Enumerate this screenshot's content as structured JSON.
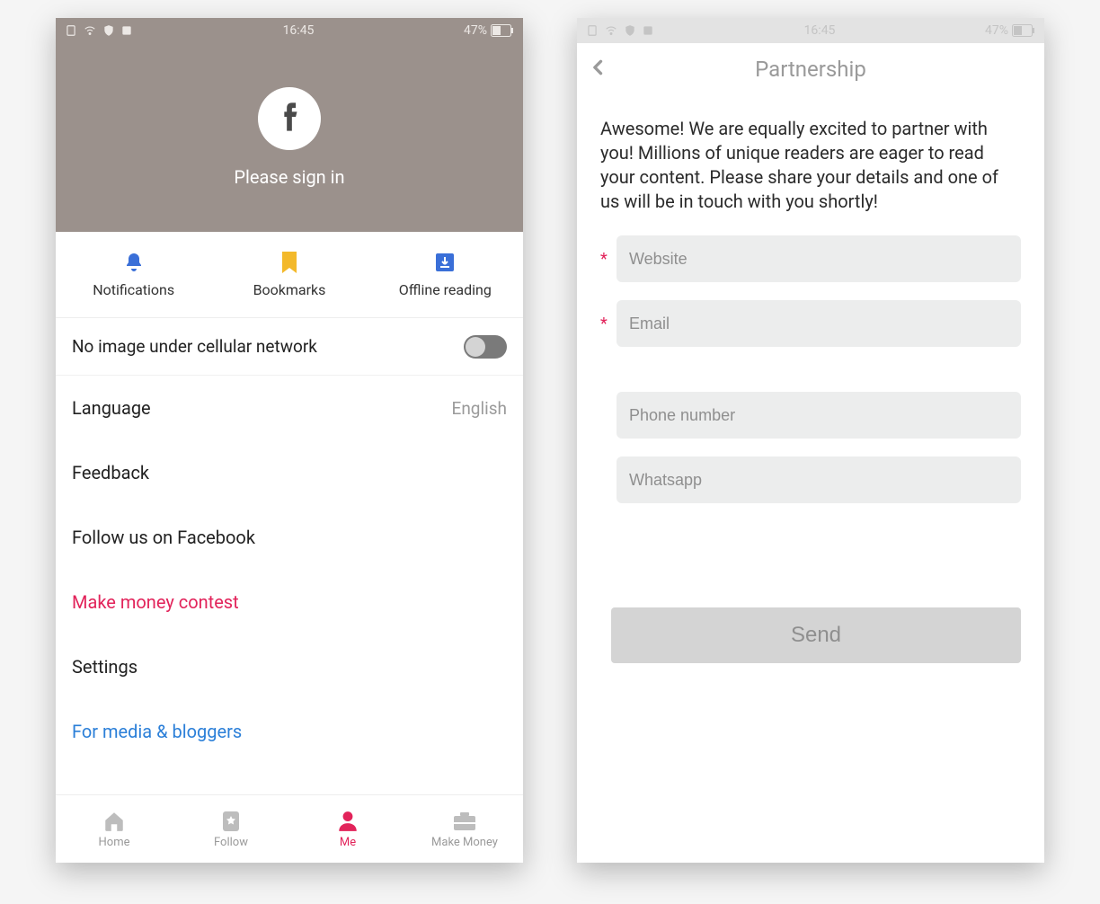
{
  "left": {
    "status": {
      "time": "16:45",
      "battery": "47%"
    },
    "hero": {
      "signin": "Please sign in"
    },
    "quick": {
      "notifications": "Notifications",
      "bookmarks": "Bookmarks",
      "offline": "Offline reading"
    },
    "toggle": {
      "label": "No image under cellular network",
      "on": false
    },
    "rows": {
      "language": {
        "label": "Language",
        "value": "English"
      },
      "feedback": "Feedback",
      "follow_fb": "Follow us on Facebook",
      "make_money": "Make money contest",
      "settings": "Settings",
      "media_bloggers": "For media & bloggers"
    },
    "nav": {
      "home": "Home",
      "follow": "Follow",
      "me": "Me",
      "make_money": "Make Money",
      "active": "me"
    }
  },
  "right": {
    "status": {
      "time": "16:45",
      "battery": "47%"
    },
    "header": {
      "title": "Partnership"
    },
    "intro": "Awesome! We are equally excited to partner with you! Millions of unique readers are eager to read your content. Please share your details and one of us will be in touch with you shortly!",
    "fields": {
      "website": {
        "placeholder": "Website",
        "required": true
      },
      "email": {
        "placeholder": "Email",
        "required": true
      },
      "phone": {
        "placeholder": "Phone number",
        "required": false
      },
      "whatsapp": {
        "placeholder": "Whatsapp",
        "required": false
      }
    },
    "send": "Send"
  }
}
